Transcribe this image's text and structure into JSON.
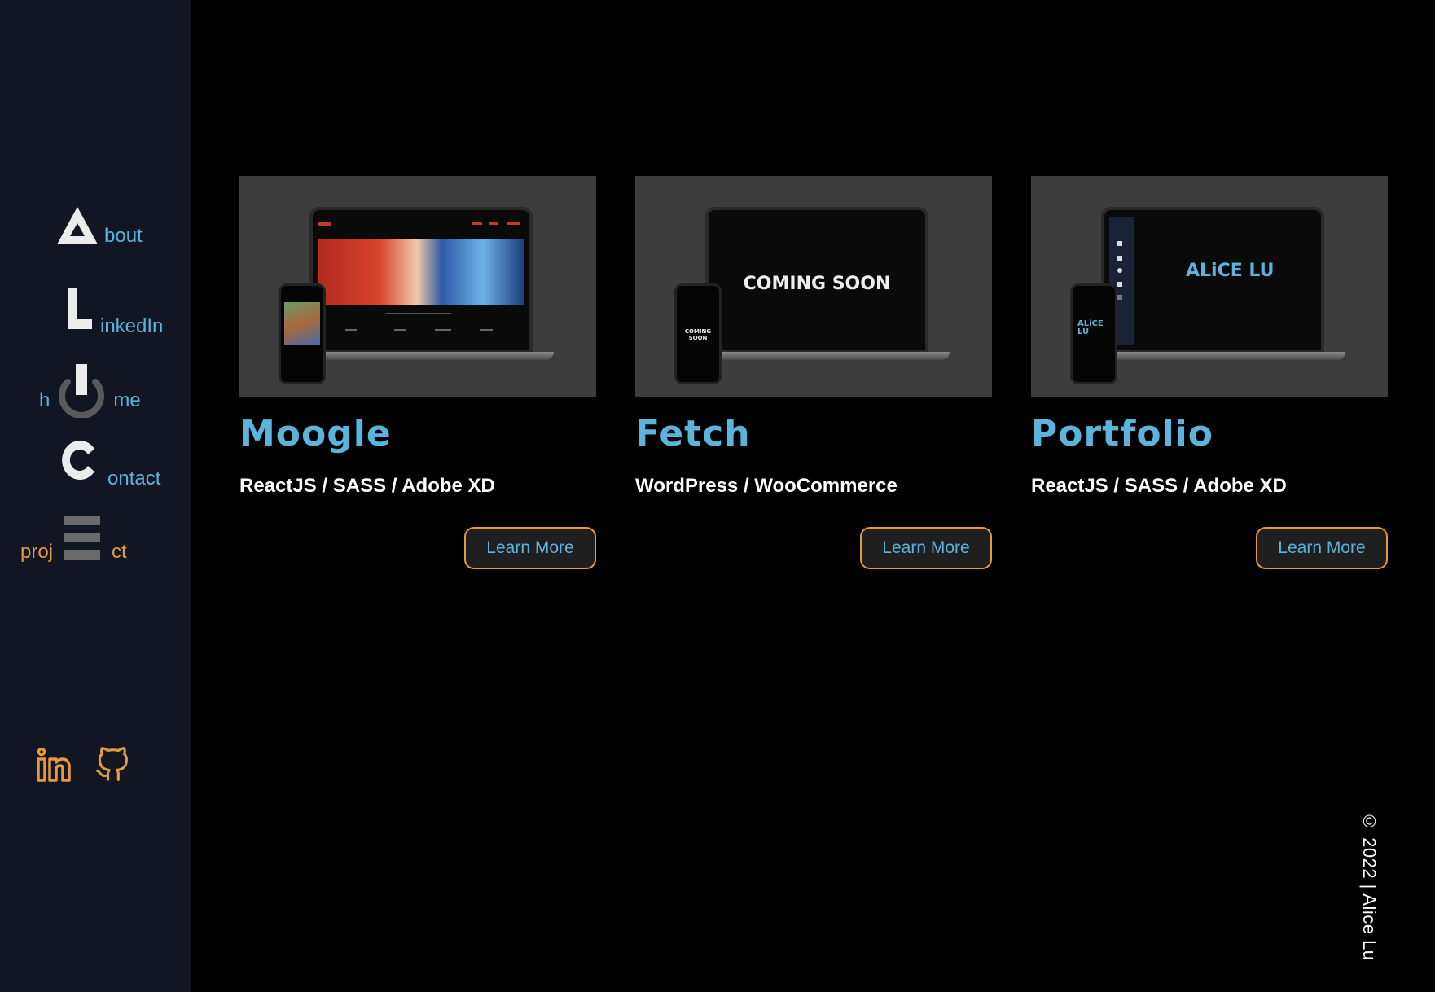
{
  "nav": {
    "about": {
      "letter": "A",
      "label": "bout",
      "icon": "a-triangle-icon"
    },
    "linkedin": {
      "letter": "L",
      "label": "inkedIn",
      "icon": "l-block-icon"
    },
    "home": {
      "prefix": "h",
      "suffix": "me",
      "icon": "power-icon"
    },
    "contact": {
      "letter": "C",
      "label": "ontact",
      "icon": "c-block-icon"
    },
    "project": {
      "prefix": "proj",
      "suffix": "ct",
      "icon": "e-bars-icon"
    }
  },
  "social": [
    {
      "name": "linkedin",
      "icon": "linkedin-icon"
    },
    {
      "name": "github",
      "icon": "github-icon"
    }
  ],
  "projects": [
    {
      "title": "Moogle",
      "tech": "ReactJS / SASS / Adobe XD",
      "button": "Learn More"
    },
    {
      "title": "Fetch",
      "tech": "WordPress / WooCommerce",
      "button": "Learn More",
      "screen_text": "COMING SOON",
      "phone_text": "COMING SOON"
    },
    {
      "title": "Portfolio",
      "tech": "ReactJS / SASS / Adobe XD",
      "button": "Learn More",
      "screen_text": "ALiCE LU",
      "phone_text": "ALiCE LU"
    }
  ],
  "copyright": "© 2022 | Alice Lu",
  "colors": {
    "sidebar_bg": "#111622",
    "accent_blue": "#5ab4dc",
    "accent_orange": "#e49a3f",
    "page_bg": "#000000"
  }
}
